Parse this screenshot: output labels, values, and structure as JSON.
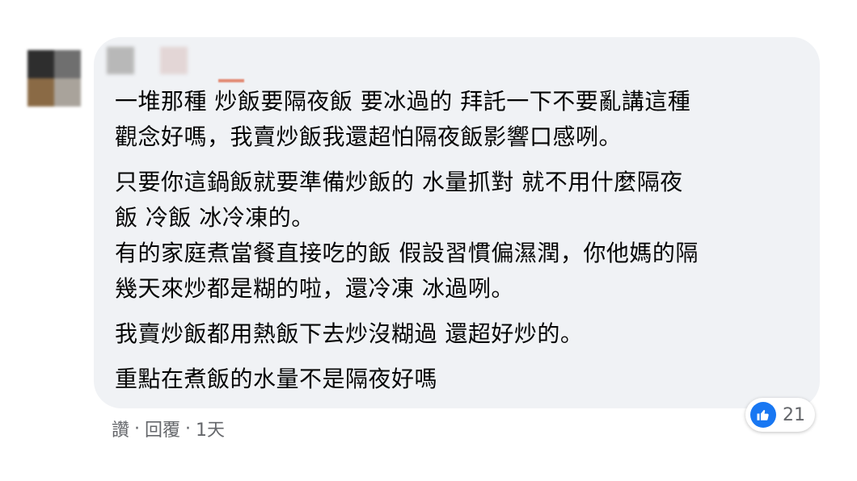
{
  "comment": {
    "lines": [
      "一堆那種 炒飯要隔夜飯 要冰過的 拜託一下不要亂講這種",
      "觀念好嗎，我賣炒飯我還超怕隔夜飯影響口感咧。",
      "只要你這鍋飯就要準備炒飯的 水量抓對 就不用什麼隔夜",
      "飯 冷飯 冰冷凍的。",
      "有的家庭煮當餐直接吃的飯 假設習慣偏濕潤，你他媽的隔",
      "幾天來炒都是糊的啦，還冷凍 冰過咧。",
      "我賣炒飯都用熱飯下去炒沒糊過 還超好炒的。",
      "重點在煮飯的水量不是隔夜好嗎"
    ]
  },
  "actions": {
    "like_label": "讚",
    "separator": "·",
    "reply_label": "回覆",
    "time_label": "1天"
  },
  "reactions": {
    "icon": "like-icon",
    "count": "21",
    "color": "#1877f2"
  },
  "colors": {
    "bubble": "#f0f2f5",
    "text": "#050505",
    "meta": "#65676b"
  }
}
